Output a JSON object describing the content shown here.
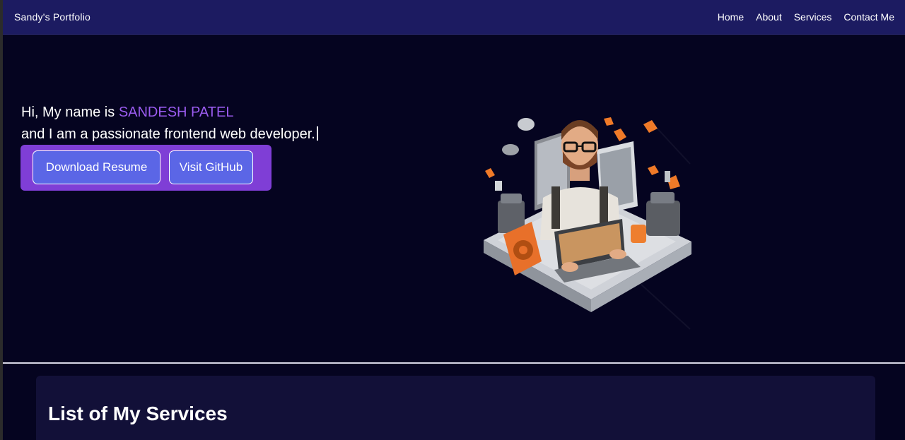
{
  "navbar": {
    "brand": "Sandy's Portfolio",
    "links": [
      "Home",
      "About",
      "Services",
      "Contact Me"
    ]
  },
  "hero": {
    "greeting": "Hi, My name is ",
    "name": "SANDESH PATEL",
    "tagline": "and I am a passionate frontend web developer.",
    "buttons": {
      "resume": "Download Resume",
      "github": "Visit GitHub"
    }
  },
  "services": {
    "title": "List of My Services"
  },
  "colors": {
    "background": "#050420",
    "navbar": "#1c1b61",
    "accent_name": "#9b5cf0",
    "button_panel": "#7f3ed6",
    "button": "#5b66e6",
    "services_card": "#121038"
  }
}
